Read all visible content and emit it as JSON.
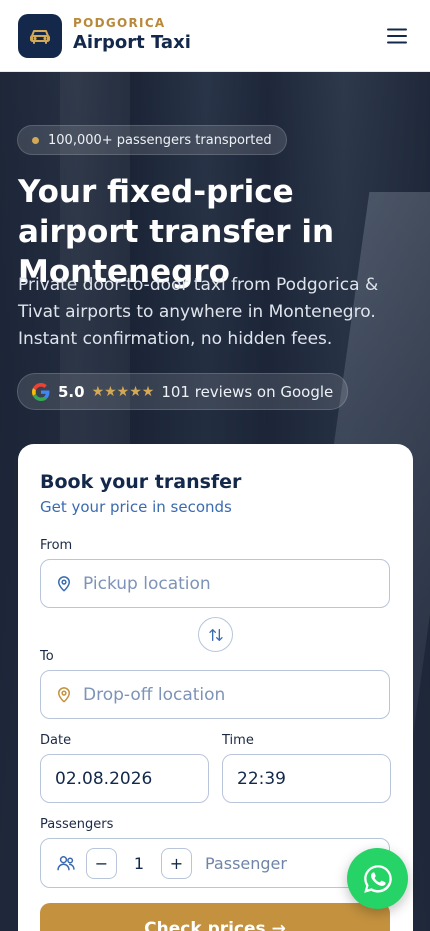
{
  "header": {
    "brand_small": "PODGORICA",
    "brand_big": "Airport Taxi",
    "menu_icon": "hamburger-icon",
    "logo_icon": "car-icon"
  },
  "hero": {
    "badge": "100,000+ passengers transported",
    "title": "Your fixed-price airport transfer in Montenegro",
    "subtitle": "Private door-to-door taxi from Podgorica & Tivat airports to anywhere in Montenegro. Instant confirmation, no hidden fees.",
    "review": {
      "rating": "5.0",
      "stars": "★★★★★",
      "text": "101 reviews on Google"
    }
  },
  "booking": {
    "title": "Book your transfer",
    "subtitle": "Get your price in seconds",
    "from_label": "From",
    "from_placeholder": "Pickup location",
    "to_label": "To",
    "to_placeholder": "Drop-off location",
    "date_label": "Date",
    "date_value": "02.08.2026",
    "time_label": "Time",
    "time_value": "22:39",
    "passengers_label": "Passengers",
    "minus": "−",
    "plus": "+",
    "passenger_count": "1",
    "passenger_unit": "Passenger",
    "cta": "Check prices →"
  },
  "colors": {
    "navy": "#13284b",
    "gold": "#c4923f",
    "whatsapp": "#25d366"
  }
}
